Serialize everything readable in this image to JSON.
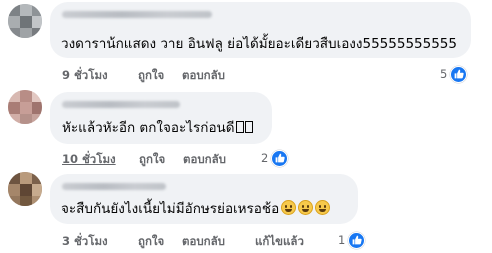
{
  "comments": [
    {
      "text": "วงดาราน้กแสดง วาย อินฟลู ย่อได้มั้ยอะเดียวสืบเองง55555555555",
      "time": "9 ชั่วโมง",
      "like_label": "ถูกใจ",
      "reply_label": "ตอบกลับ",
      "reaction_count": "5"
    },
    {
      "text": "หัะแล้วหัะอีก ตกใจอะไรก่อนดี",
      "time": "10 ชั่วโมง",
      "like_label": "ถูกใจ",
      "reply_label": "ตอบกลับ",
      "reaction_count": "2"
    },
    {
      "text": "จะสืบกันยังไงเนี้ยไม่มีอักษรย่อเหรอช้อ",
      "time": "3 ชั่วโมง",
      "like_label": "ถูกใจ",
      "reply_label": "ตอบกลับ",
      "edited_label": "แก้ไขแล้ว",
      "reaction_count": "1"
    }
  ],
  "colors": {
    "bubble": "#f0f2f5",
    "meta_text": "#65676b",
    "like_blue": "#1877f2",
    "emoji_yellow": "#f7c94b"
  },
  "icons": {
    "reaction": "thumbs-up-icon",
    "emoji": "grinning-face-icon",
    "unknown_glyph": "missing-glyph-box"
  }
}
